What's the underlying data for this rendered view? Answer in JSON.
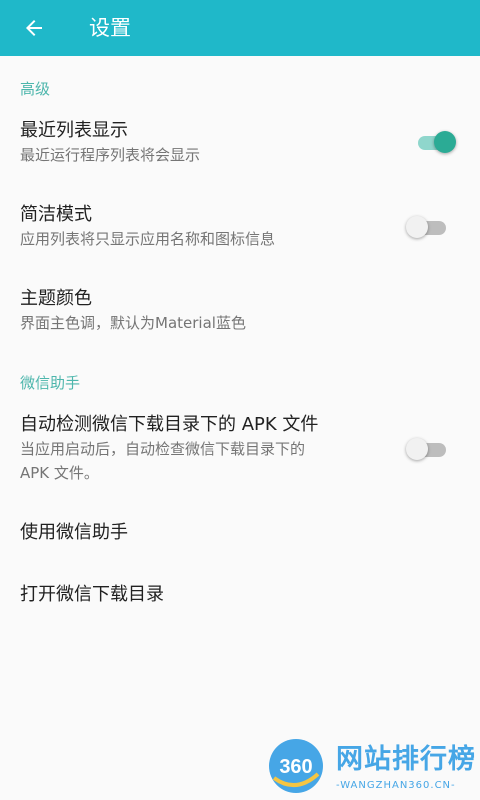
{
  "appbar": {
    "title": "设置",
    "back_icon": "arrow-back-icon",
    "background_color": "#1fb8c9"
  },
  "accent_color": "#4db6ac",
  "sections": [
    {
      "header": "高级",
      "items": [
        {
          "title": "最近列表显示",
          "subtitle": "最近运行程序列表将会显示",
          "switch": true
        },
        {
          "title": "简洁模式",
          "subtitle": "应用列表将只显示应用名称和图标信息",
          "switch": false
        },
        {
          "title": "主题颜色",
          "subtitle": "界面主色调，默认为Material蓝色"
        }
      ]
    },
    {
      "header": "微信助手",
      "items": [
        {
          "title": "自动检测微信下载目录下的 APK 文件",
          "subtitle_line1": "当应用启动后，自动检查微信下载目录下的",
          "subtitle_line2": "APK 文件。",
          "switch": false
        },
        {
          "title": "使用微信助手"
        },
        {
          "title": "打开微信下载目录"
        }
      ]
    }
  ],
  "watermark": {
    "logo_text": "360",
    "main_text": "网站排行榜",
    "sub_text": "-WANGZHAN360.CN-"
  }
}
